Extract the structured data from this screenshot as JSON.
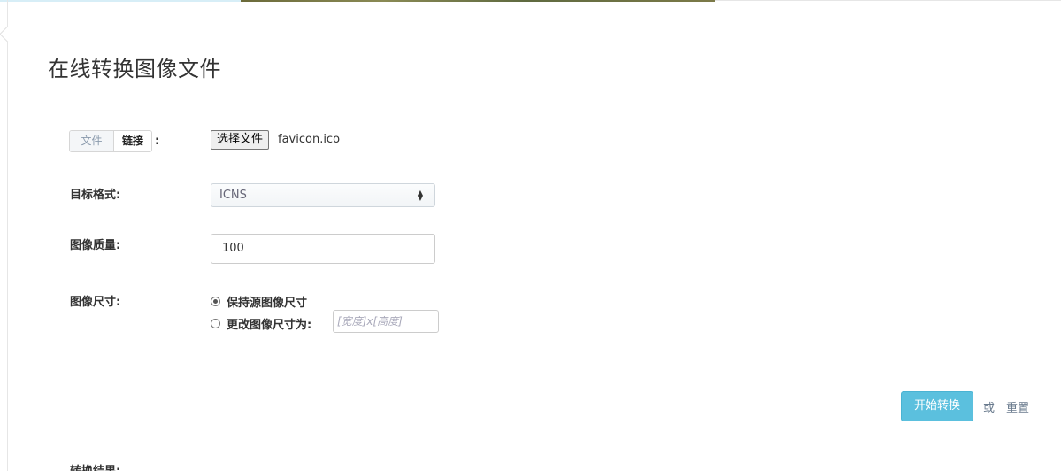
{
  "page": {
    "title": "在线转换图像文件"
  },
  "source": {
    "tabs": [
      {
        "label": "文件"
      },
      {
        "label": "链接"
      }
    ],
    "colon": ":",
    "file_button_label": "选择文件",
    "file_name": "favicon.ico"
  },
  "target_format": {
    "label": "目标格式:",
    "selected": "ICNS"
  },
  "quality": {
    "label": "图像质量:",
    "value": "100"
  },
  "image_size": {
    "label": "图像尺寸:",
    "options": [
      {
        "label": "保持源图像尺寸",
        "checked": true
      },
      {
        "label": "更改图像尺寸为:",
        "checked": false
      }
    ],
    "size_placeholder": "[宽度]x[高度]"
  },
  "actions": {
    "convert_label": "开始转换",
    "or_text": "或",
    "reset_label": "重置"
  },
  "result": {
    "label": "转换结果:"
  },
  "colors": {
    "accent": "#5bc0de",
    "link": "#6a7b8e"
  }
}
